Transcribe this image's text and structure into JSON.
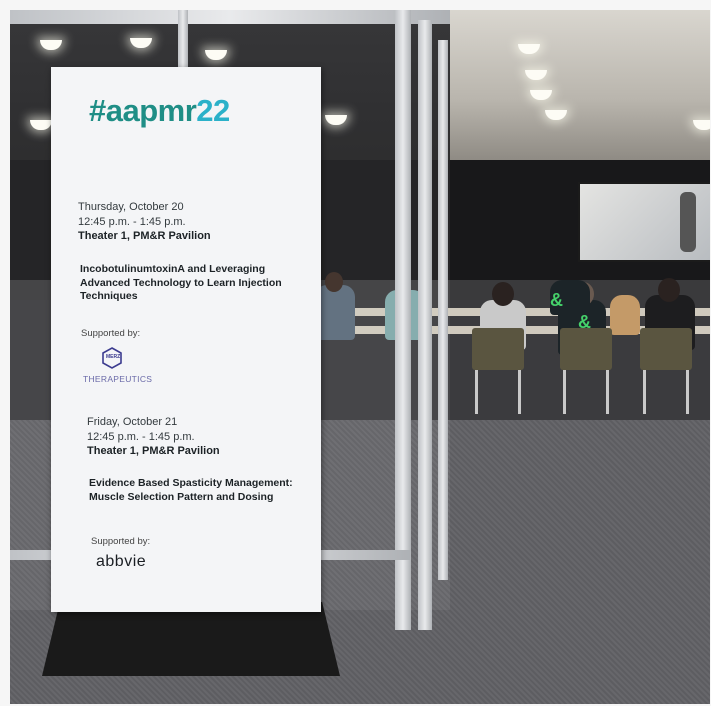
{
  "sign": {
    "hashtag_main": "#aapmr",
    "hashtag_accent": "22",
    "session1": {
      "date": "Thursday, October 20",
      "time": "12:45 p.m. - 1:45 p.m.",
      "location": "Theater 1, PM&R Pavilion",
      "title": "IncobotulinumtoxinA and Leveraging Advanced Technology to Learn Injection Techniques",
      "supported_by": "Supported by:",
      "sponsor_badge": "MERZ",
      "sponsor_name": "THERAPEUTICS"
    },
    "session2": {
      "date": "Friday, October 21",
      "time": "12:45 p.m. - 1:45 p.m.",
      "location": "Theater 1, PM&R Pavilion",
      "title": "Evidence Based Spasticity Management: Muscle Selection Pattern and Dosing",
      "supported_by": "Supported by:",
      "sponsor_name": "abbvie"
    }
  },
  "colors": {
    "hashtag_teal": "#1f8e86",
    "hashtag_accent_blue": "#2bb1c9",
    "ampersand_green": "#45d16a"
  },
  "audience_symbol": "&"
}
